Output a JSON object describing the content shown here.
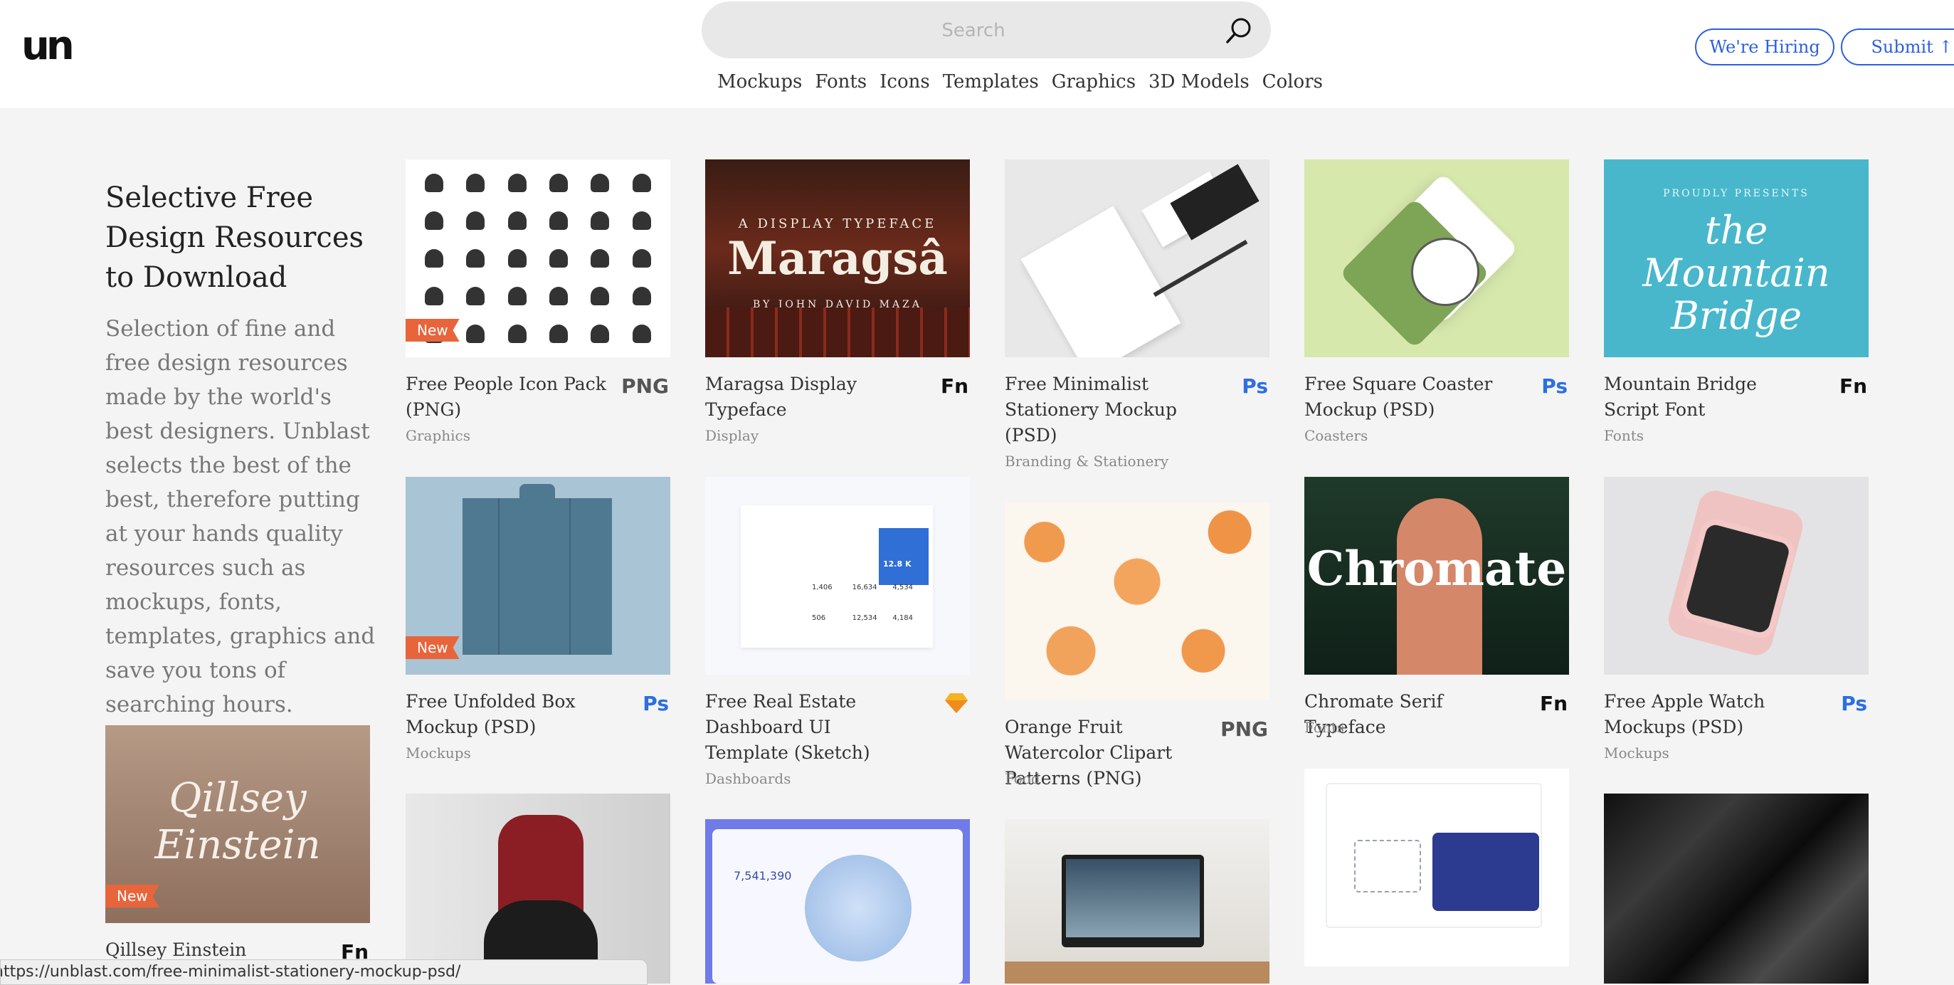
{
  "header": {
    "logo": "un",
    "search_placeholder": "Search",
    "nav": [
      "Mockups",
      "Fonts",
      "Icons",
      "Templates",
      "Graphics",
      "3D Models",
      "Colors"
    ],
    "hiring_label": "We're Hiring",
    "submit_label": "Submit ↑"
  },
  "intro": {
    "heading": "Selective Free Design Resources to Download",
    "body": "Selection of fine and free design resources made by the world's best designers. Unblast selects the best of the best, therefore putting at your hands quality resources such as mockups, fonts, templates, graphics and save you tons of searching hours."
  },
  "cards": [
    {
      "title": "Free People Icon Pack (PNG)",
      "category": "Graphics",
      "type": "PNG",
      "badge": "New"
    },
    {
      "title": "Maragsa Display Typeface",
      "category": "Display",
      "type": "Fn",
      "badge": "",
      "thumb_tag": "A DISPLAY TYPEFACE",
      "thumb_word": "Maragsâ",
      "thumb_sub": "BY JOHN DAVID MAZA"
    },
    {
      "title": "Free Minimalist Stationery Mockup (PSD)",
      "category": "Branding & Stationery",
      "type": "Ps",
      "badge": ""
    },
    {
      "title": "Free Square Coaster Mockup (PSD)",
      "category": "Coasters",
      "type": "Ps",
      "badge": ""
    },
    {
      "title": "Mountain Bridge Script Font",
      "category": "Fonts",
      "type": "Fn",
      "badge": "",
      "thumb_tag": "PROUDLY PRESENTS",
      "thumb_word": "the Mountain Bridge"
    },
    {
      "title": "Free Unfolded Box Mockup (PSD)",
      "category": "Mockups",
      "type": "Ps",
      "badge": "New"
    },
    {
      "title": "Free Real Estate Dashboard UI Template (Sketch)",
      "category": "Dashboards",
      "type": "sketch",
      "badge": "",
      "thumb_stats": [
        "1,406",
        "16,634",
        "4,534",
        "506",
        "12,534",
        "4,184"
      ],
      "thumb_metric": "12.8 K"
    },
    {
      "title": "Orange Fruit Watercolor Clipart Patterns (PNG)",
      "category": "Food",
      "type": "PNG",
      "badge": ""
    },
    {
      "title": "Chromate Serif Typeface",
      "category": "Fonts",
      "type": "Fn",
      "badge": "",
      "thumb_word": "Chromate"
    },
    {
      "title": "Free Apple Watch Mockups (PSD)",
      "category": "Mockups",
      "type": "Ps",
      "badge": ""
    },
    {
      "title": "Qillsey Einstein",
      "category": "",
      "type": "Fn",
      "badge": "New",
      "thumb_word": "Qillsey Einstein"
    },
    {
      "title": "",
      "category": "",
      "type": "",
      "badge": ""
    },
    {
      "title": "",
      "category": "",
      "type": "",
      "badge": "",
      "thumb_stats": [
        "7,541,390"
      ]
    },
    {
      "title": "",
      "category": "",
      "type": "",
      "badge": ""
    },
    {
      "title": "",
      "category": "",
      "type": "",
      "badge": ""
    },
    {
      "title": "",
      "category": "",
      "type": "",
      "badge": ""
    }
  ],
  "status_url": "https://unblast.com/free-minimalist-stationery-mockup-psd/",
  "colors": {
    "accent": "#2c5fe0",
    "badge": "#e8653c",
    "ps_blue": "#2c6fe0"
  }
}
